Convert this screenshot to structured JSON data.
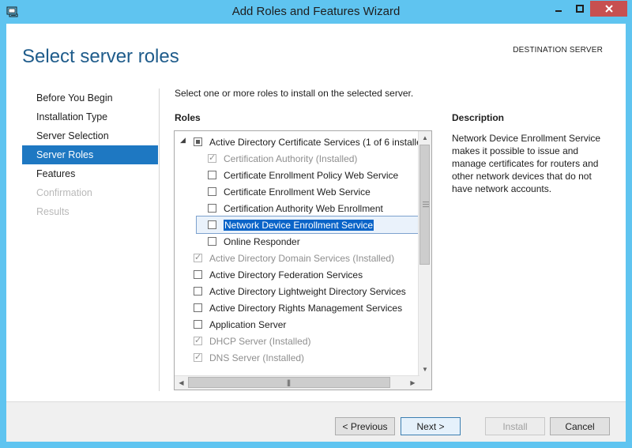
{
  "window": {
    "title": "Add Roles and Features Wizard",
    "accent": "#5fc4f0",
    "close_color": "#c75050"
  },
  "page": {
    "title": "Select server roles",
    "destination_label": "DESTINATION SERVER"
  },
  "nav": {
    "items": [
      {
        "label": "Before You Begin",
        "state": "normal"
      },
      {
        "label": "Installation Type",
        "state": "normal"
      },
      {
        "label": "Server Selection",
        "state": "normal"
      },
      {
        "label": "Server Roles",
        "state": "active"
      },
      {
        "label": "Features",
        "state": "normal"
      },
      {
        "label": "Confirmation",
        "state": "disabled"
      },
      {
        "label": "Results",
        "state": "disabled"
      }
    ]
  },
  "main": {
    "instruction": "Select one or more roles to install on the selected server.",
    "roles_label": "Roles",
    "roles": [
      {
        "label": "Active Directory Certificate Services (1 of 6 installe",
        "state": "partial",
        "disabled": false,
        "expanded": true
      },
      {
        "label": "Certification Authority (Installed)",
        "state": "checked",
        "disabled": true
      },
      {
        "label": "Certificate Enrollment Policy Web Service",
        "state": "unchecked",
        "disabled": false
      },
      {
        "label": "Certificate Enrollment Web Service",
        "state": "unchecked",
        "disabled": false
      },
      {
        "label": "Certification Authority Web Enrollment",
        "state": "unchecked",
        "disabled": false
      },
      {
        "label": "Network Device Enrollment Service",
        "state": "unchecked",
        "disabled": false,
        "selected": true
      },
      {
        "label": "Online Responder",
        "state": "unchecked",
        "disabled": false
      },
      {
        "label": "Active Directory Domain Services (Installed)",
        "state": "checked",
        "disabled": true
      },
      {
        "label": "Active Directory Federation Services",
        "state": "unchecked",
        "disabled": false
      },
      {
        "label": "Active Directory Lightweight Directory Services",
        "state": "unchecked",
        "disabled": false
      },
      {
        "label": "Active Directory Rights Management Services",
        "state": "unchecked",
        "disabled": false
      },
      {
        "label": "Application Server",
        "state": "unchecked",
        "disabled": false
      },
      {
        "label": "DHCP Server (Installed)",
        "state": "checked",
        "disabled": true
      },
      {
        "label": "DNS Server (Installed)",
        "state": "checked",
        "disabled": true
      }
    ],
    "description_label": "Description",
    "description_text": "Network Device Enrollment Service makes it possible to issue and manage certificates for routers and other network devices that do not have network accounts."
  },
  "footer": {
    "previous": "< Previous",
    "next": "Next >",
    "install": "Install",
    "cancel": "Cancel"
  }
}
